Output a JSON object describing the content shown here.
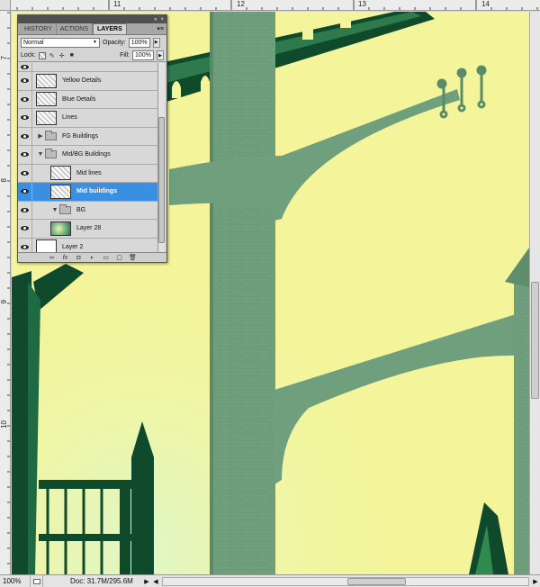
{
  "rulers": {
    "top_labels": [
      "11",
      "12",
      "13",
      "14"
    ],
    "left_labels": [
      "7",
      "8",
      "9",
      "10"
    ]
  },
  "layers_panel": {
    "tabs": [
      {
        "label": "HISTORY",
        "active": false
      },
      {
        "label": "ACTIONS",
        "active": false
      },
      {
        "label": "LAYERS",
        "active": true
      }
    ],
    "blend_mode": "Normal",
    "opacity_label": "Opacity:",
    "opacity_value": "100%",
    "lock_label": "Lock:",
    "fill_label": "Fill:",
    "fill_value": "100%",
    "layers": [
      {
        "name": "Yellow Details",
        "type": "layer",
        "selected": false
      },
      {
        "name": "Blue Details",
        "type": "layer",
        "selected": false
      },
      {
        "name": "Lines",
        "type": "layer",
        "selected": false
      },
      {
        "name": "FG Buildings",
        "type": "group-collapsed",
        "selected": false
      },
      {
        "name": "Mid/BG Buildings",
        "type": "group-expanded",
        "selected": false
      },
      {
        "name": "Mid lines",
        "type": "layer-nested",
        "selected": false
      },
      {
        "name": "Mid buildings",
        "type": "layer-nested",
        "selected": true
      },
      {
        "name": "BG",
        "type": "group-expanded-nested",
        "selected": false
      },
      {
        "name": "Layer 28",
        "type": "layer-nested-green",
        "selected": false
      },
      {
        "name": "Layer 2",
        "type": "layer-white",
        "selected": false
      }
    ],
    "footer_icons": [
      "link-icon",
      "fx-icon",
      "mask-icon",
      "adjustment-icon",
      "folder-icon",
      "new-layer-icon",
      "trash-icon"
    ]
  },
  "status": {
    "zoom": "100%",
    "doc": "Doc: 31.7M/295.6M"
  },
  "colors": {
    "canvas_yellow": "#f4f59a",
    "building_green": "#6f9f7c",
    "dark_green": "#0f4a2c",
    "selected_blue": "#3b8fe3"
  }
}
